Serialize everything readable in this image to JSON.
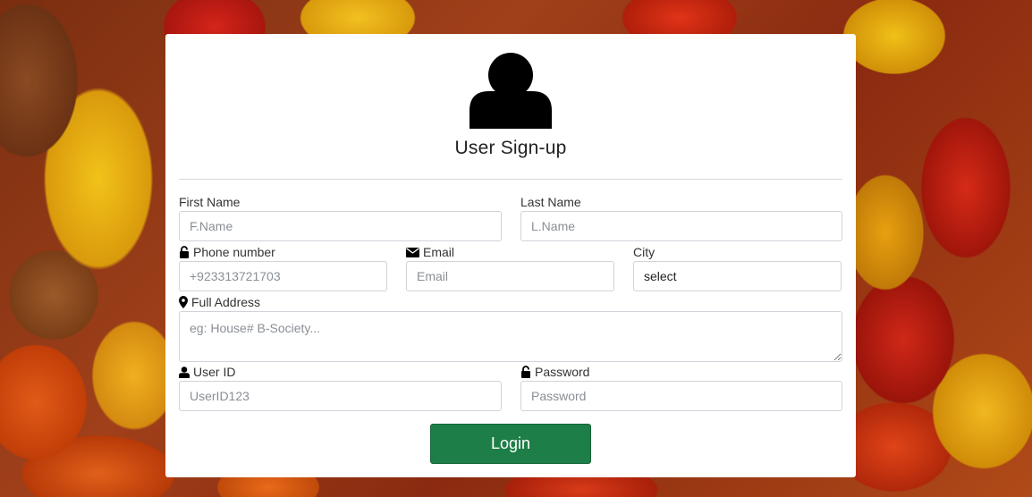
{
  "form": {
    "title": "User Sign-up",
    "first_name": {
      "label": "First Name",
      "placeholder": "F.Name"
    },
    "last_name": {
      "label": "Last Name",
      "placeholder": "L.Name"
    },
    "phone": {
      "label": "Phone number",
      "placeholder": "+923313721703",
      "icon": "unlock-icon"
    },
    "email": {
      "label": "Email",
      "placeholder": "Email",
      "icon": "envelope-icon"
    },
    "city": {
      "label": "City",
      "selected": "select"
    },
    "address": {
      "label": "Full Address",
      "placeholder": "eg: House# B-Society...",
      "icon": "map-marker-icon"
    },
    "user_id": {
      "label": "User ID",
      "placeholder": "UserID123",
      "icon": "user-icon"
    },
    "password": {
      "label": "Password",
      "placeholder": "Password",
      "icon": "lock-icon"
    },
    "submit_label": "Login"
  },
  "colors": {
    "button": "#1e7e48",
    "card": "#ffffff",
    "text": "#222222"
  }
}
